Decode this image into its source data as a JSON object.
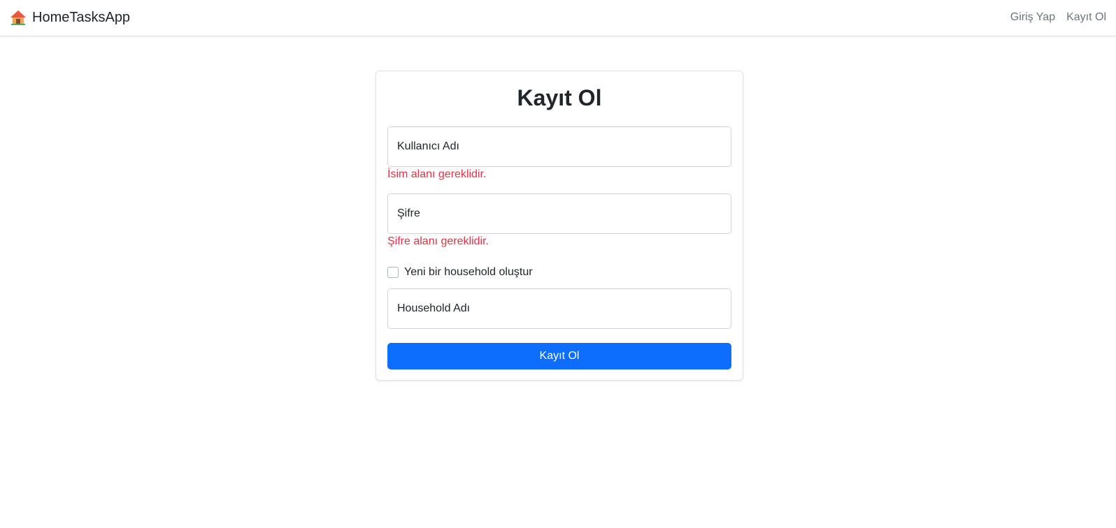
{
  "navbar": {
    "brand_icon": "house-icon",
    "brand_text": "HomeTasksApp",
    "links": [
      {
        "label": "Giriş Yap"
      },
      {
        "label": "Kayıt Ol"
      }
    ]
  },
  "form": {
    "title": "Kayıt Ol",
    "username_label": "Kullanıcı Adı",
    "username_error": "İsim alanı gereklidir.",
    "password_label": "Şifre",
    "password_error": "Şifre alanı gereklidir.",
    "create_household_label": "Yeni bir household oluştur",
    "create_household_checked": false,
    "household_label": "Household Adı",
    "submit_label": "Kayıt Ol"
  },
  "colors": {
    "primary": "#0d6efd",
    "error": "#dc3545",
    "nav_link": "#6c757d"
  }
}
